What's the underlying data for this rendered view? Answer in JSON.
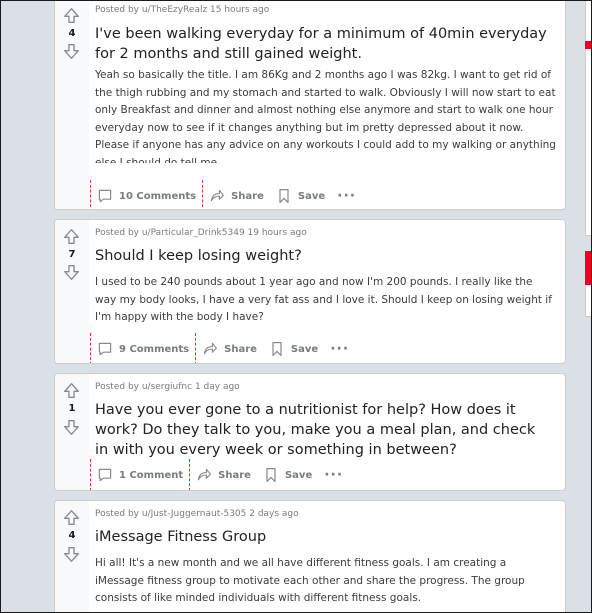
{
  "posts": [
    {
      "score": "4",
      "meta": "Posted by u/TheEzyRealz 15 hours ago",
      "title": "I've been walking everyday for a minimum of 40min everyday for 2 months and still gained weight.",
      "body": "Yeah so basically the title. I am 86Kg and 2 months ago I was 82kg. I want to get rid of the thigh rubbing and my stomach and started to walk. Obviously I will now start to eat only Breakfast and dinner and almost nothing else anymore and start to walk one hour everyday now to see if it changes anything but im pretty depressed about it now. Please if anyone has any advice on any workouts I could add to my walking or anything else I should do tell me.",
      "comments": "10 Comments",
      "share": "Share",
      "save": "Save"
    },
    {
      "score": "7",
      "meta": "Posted by u/Particular_Drink5349 19 hours ago",
      "title": "Should I keep losing weight?",
      "body": "I used to be 240 pounds about 1 year ago and now I'm 200 pounds. I really like the way my body looks, I have a very fat ass and I love it. Should I keep on losing weight if I'm happy with the body I have?",
      "comments": "9 Comments",
      "share": "Share",
      "save": "Save"
    },
    {
      "score": "1",
      "meta": "Posted by u/sergiufnc 1 day ago",
      "title": "Have you ever gone to a nutritionist for help? How does it work? Do they talk to you, make you a meal plan, and check in with you every week or something in between?",
      "body": "",
      "comments": "1 Comment",
      "share": "Share",
      "save": "Save"
    },
    {
      "score": "4",
      "meta": "Posted by u/Just-Juggernaut-5305 2 days ago",
      "title": "iMessage Fitness Group",
      "body": "Hi all! It's a new month and we all have different fitness goals. I am creating a iMessage fitness group to motivate each other and share the progress. The group consists of like minded individuals with different fitness goals.",
      "comments": "",
      "share": "",
      "save": ""
    }
  ],
  "more_label": "···",
  "colors": {
    "background": "#dae0e6",
    "accent": "#ea0027",
    "muted": "#787c7e"
  }
}
